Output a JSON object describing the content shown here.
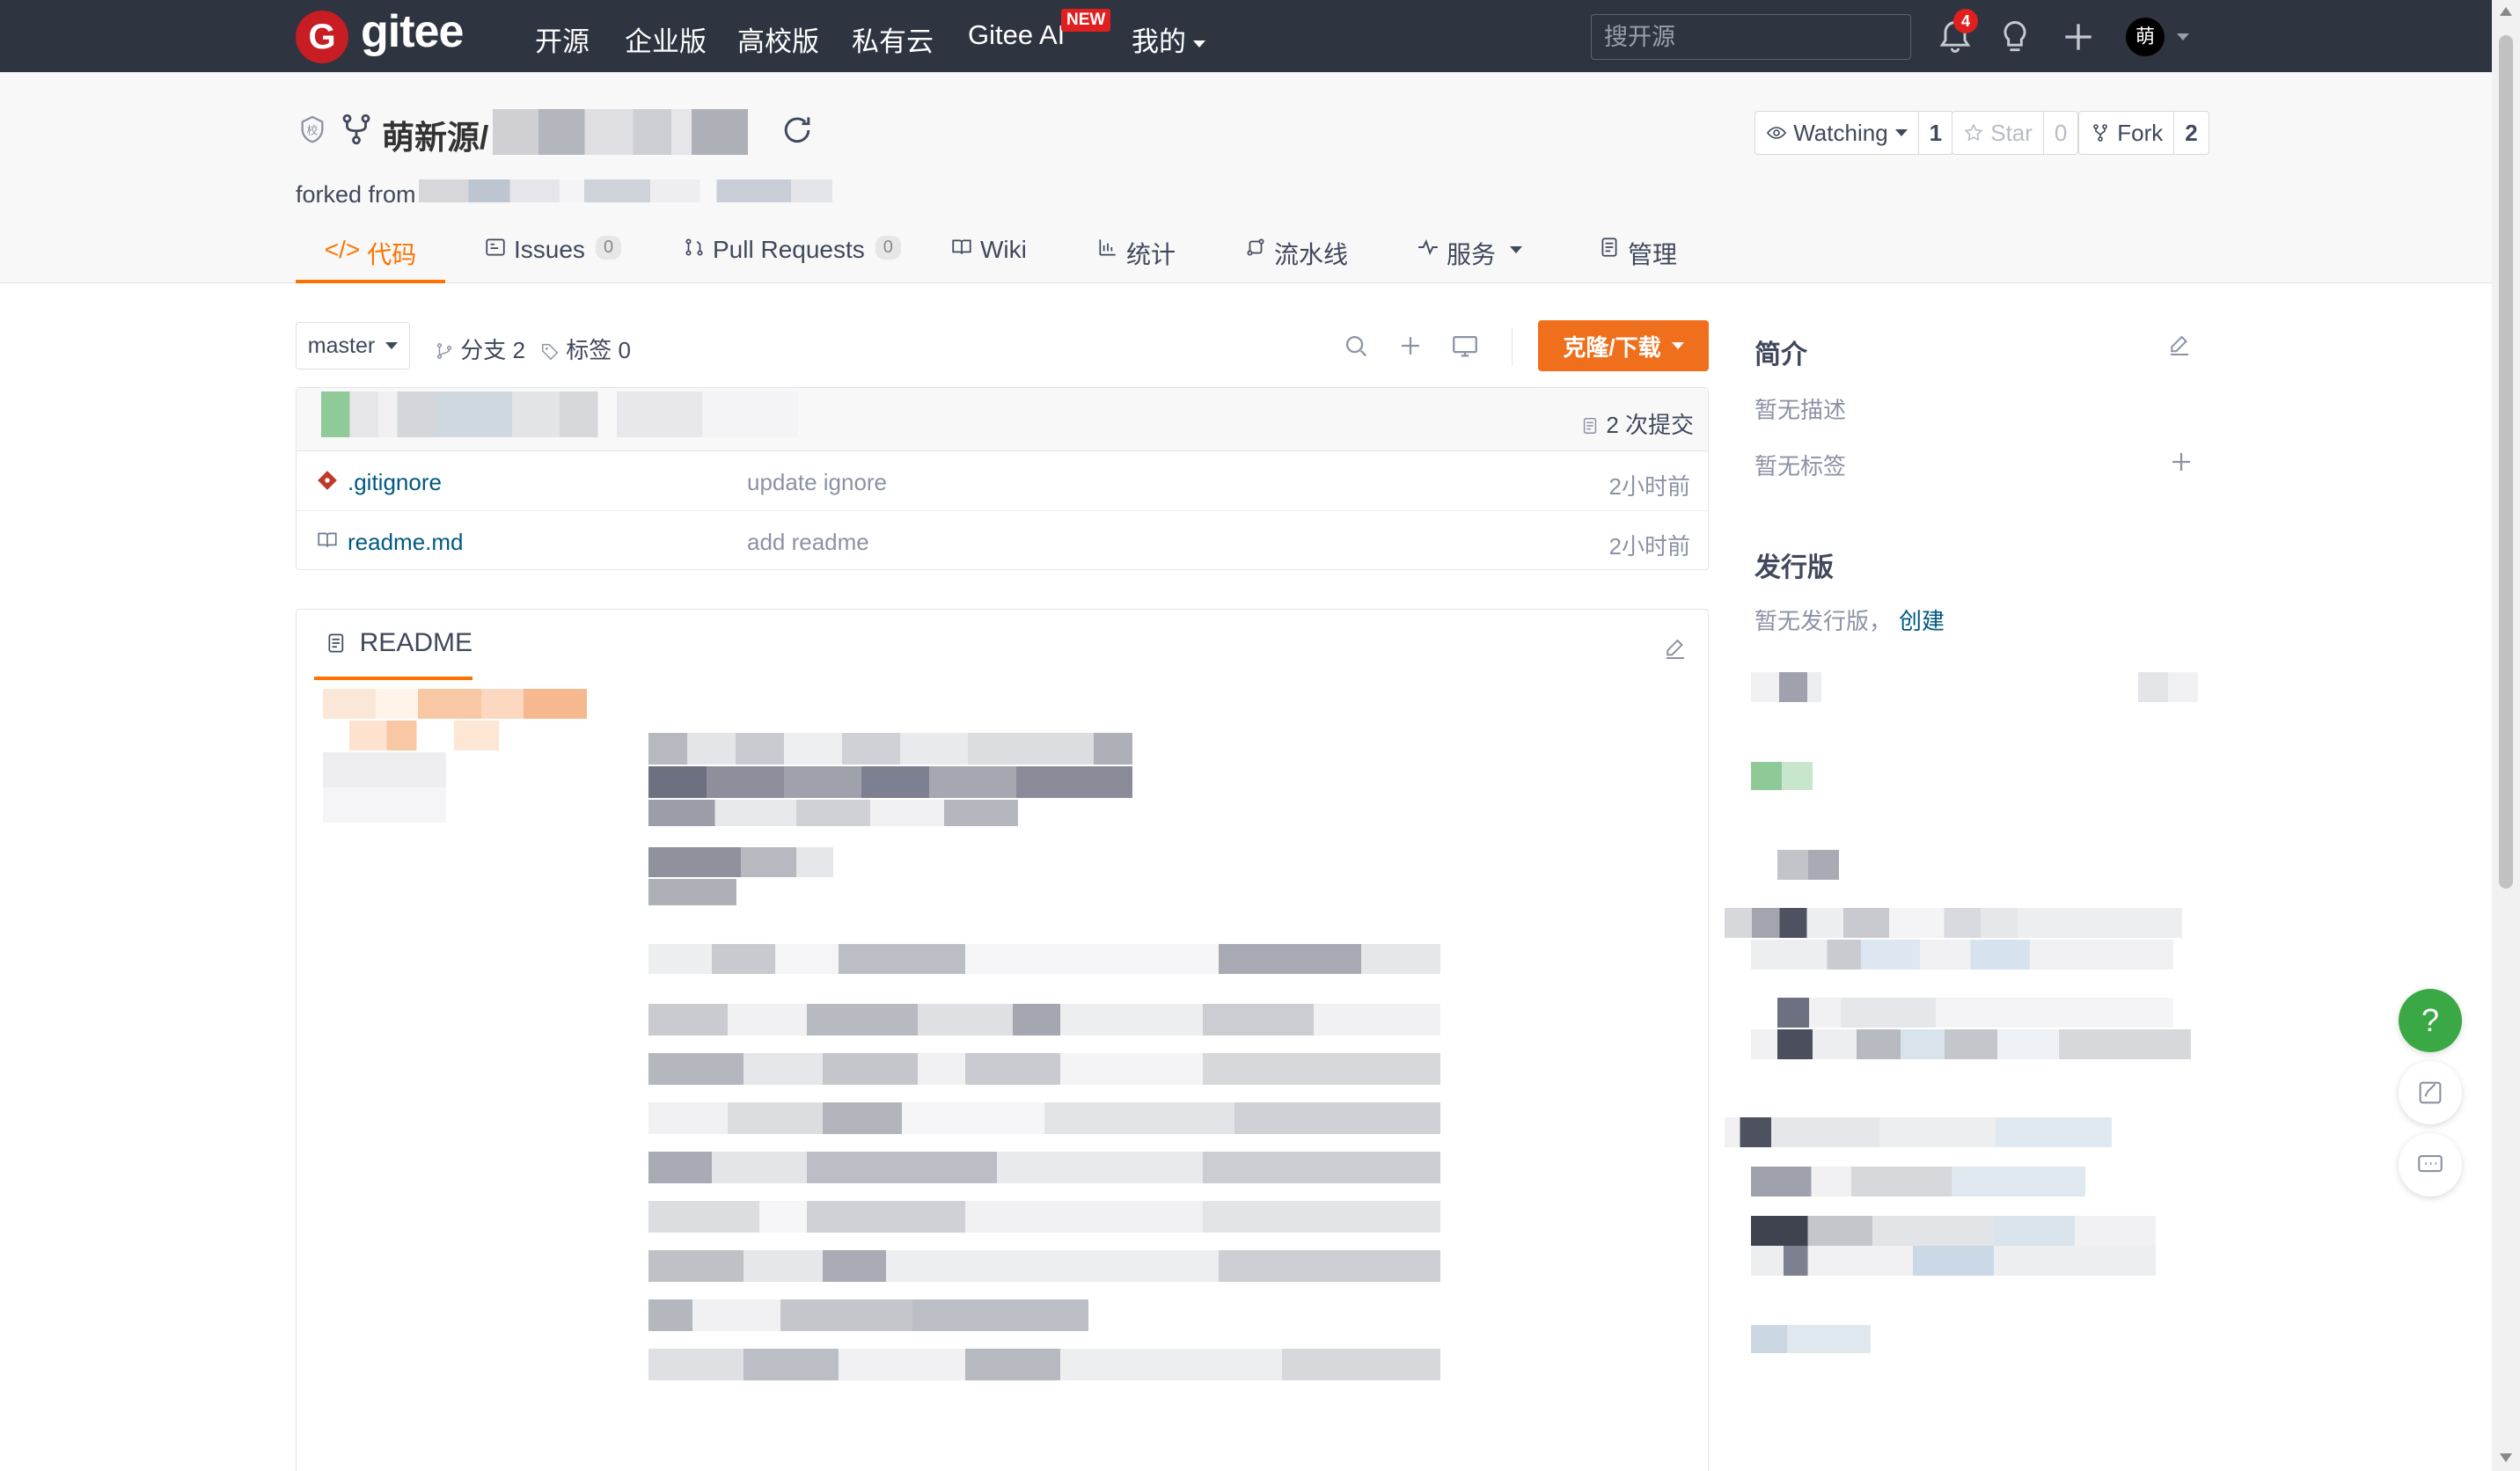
{
  "navbar": {
    "logo_letter": "G",
    "logo_text": "gitee",
    "links": [
      "开源",
      "企业版",
      "高校版",
      "私有云",
      "Gitee AI",
      "我的"
    ],
    "new_badge": "NEW",
    "search_placeholder": "搜开源",
    "notification_count": "4",
    "avatar_text": "萌",
    "icons": [
      "bell-icon",
      "lightbulb-icon",
      "plus-icon"
    ]
  },
  "repo": {
    "badge_text": "校",
    "owner": "萌新源/",
    "forked_from_label": "forked from ",
    "watch_label": "Watching",
    "watch_count": "1",
    "star_label": "Star",
    "star_count": "0",
    "fork_label": "Fork",
    "fork_count": "2"
  },
  "tabs": {
    "code": "代码",
    "issues": "Issues",
    "issues_count": "0",
    "pull_requests": "Pull Requests",
    "pull_requests_count": "0",
    "wiki": "Wiki",
    "stats": "统计",
    "pipeline": "流水线",
    "services": "服务",
    "manage": "管理"
  },
  "toolbar": {
    "branch": "master",
    "branches": "分支 2",
    "tags": "标签 0",
    "clone_button": "克隆/下载"
  },
  "files": {
    "commit_count": "2 次提交",
    "rows": [
      {
        "name": ".gitignore",
        "message": "update ignore",
        "time": "2小时前"
      },
      {
        "name": "readme.md",
        "message": "add readme",
        "time": "2小时前"
      }
    ]
  },
  "readme": {
    "title": "README"
  },
  "sidebar": {
    "intro_title": "简介",
    "no_description": "暂无描述",
    "no_tags": "暂无标签",
    "releases_title": "发行版",
    "no_releases": "暂无发行版，",
    "create_link": "创建"
  },
  "floating": {
    "help": "?"
  },
  "colors": {
    "navbar_bg": "#2e3440",
    "accent_orange": "#fe7300",
    "clone_button": "#f06f1d",
    "link_blue": "#005980",
    "help_green": "#3aa845",
    "brand_red": "#c71d23"
  }
}
